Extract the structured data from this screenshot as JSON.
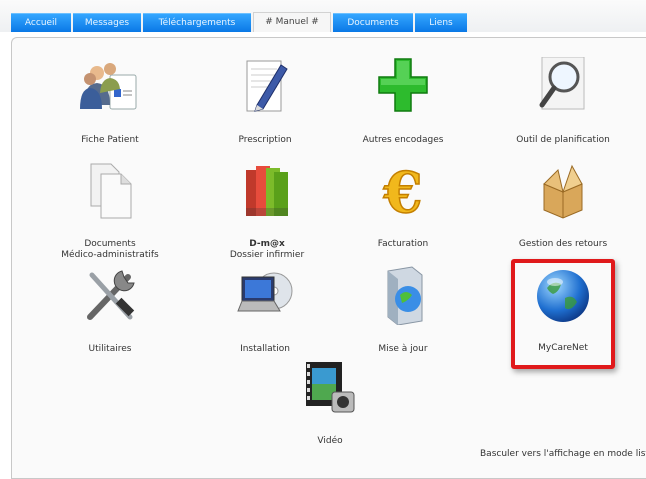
{
  "tabs": [
    {
      "label": "Accueil",
      "active": false
    },
    {
      "label": "Messages",
      "active": false
    },
    {
      "label": "Téléchargements",
      "active": false
    },
    {
      "label": "# Manuel #",
      "active": true
    },
    {
      "label": "Documents",
      "active": false
    },
    {
      "label": "Liens",
      "active": false
    }
  ],
  "items": {
    "fiche_patient": {
      "label": "Fiche Patient",
      "icon": "patients-icon"
    },
    "prescription": {
      "label": "Prescription",
      "icon": "pen-paper-icon"
    },
    "autres_encodages": {
      "label": "Autres encodages",
      "icon": "green-cross-icon"
    },
    "outil_planification": {
      "label": "Outil de planification",
      "icon": "magnifier-icon"
    },
    "documents": {
      "label_line1": "Documents",
      "label_line2": "Médico-administratifs",
      "icon": "documents-icon"
    },
    "dmx": {
      "label_line1": "D-m@x",
      "label_line2": "Dossier infirmier",
      "icon": "binders-icon"
    },
    "facturation": {
      "label": "Facturation",
      "icon": "euro-icon"
    },
    "gestion_retours": {
      "label": "Gestion des retours",
      "icon": "open-box-icon"
    },
    "utilitaires": {
      "label": "Utilitaires",
      "icon": "tools-icon"
    },
    "installation": {
      "label": "Installation",
      "icon": "laptop-cd-icon"
    },
    "mise_a_jour": {
      "label": "Mise à jour",
      "icon": "software-box-icon"
    },
    "mycarenet": {
      "label": "MyCareNet",
      "icon": "globe-icon"
    },
    "video": {
      "label": "Vidéo",
      "icon": "film-camera-icon"
    }
  },
  "footer_link": "Basculer vers l'affichage en mode liste",
  "colors": {
    "tab_blue": "#1e8ff5",
    "highlight": "#e0191b"
  }
}
